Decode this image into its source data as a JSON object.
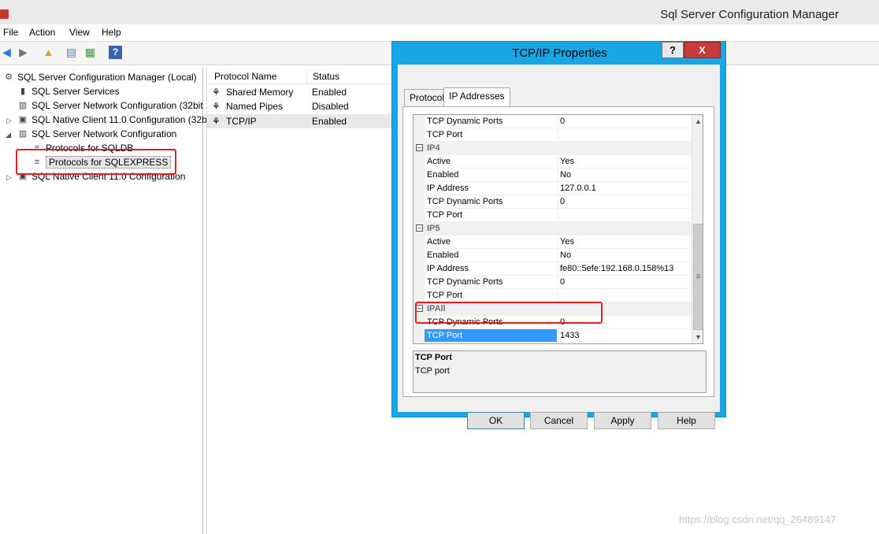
{
  "window": {
    "title": "Sql Server Configuration Manager"
  },
  "menu": [
    "File",
    "Action",
    "View",
    "Help"
  ],
  "tree": {
    "root": "SQL Server Configuration Manager (Local)",
    "items": [
      "SQL Server Services",
      "SQL Server Network Configuration (32bit",
      "SQL Native Client 11.0 Configuration (32b",
      "SQL Server Network Configuration",
      "Protocols for SQLDB",
      "Protocols for SQLEXPRESS",
      "SQL Native Client 11.0 Configuration"
    ]
  },
  "list": {
    "columns": [
      "Protocol Name",
      "Status"
    ],
    "rows": [
      {
        "name": "Shared Memory",
        "status": "Enabled"
      },
      {
        "name": "Named Pipes",
        "status": "Disabled"
      },
      {
        "name": "TCP/IP",
        "status": "Enabled"
      }
    ]
  },
  "dialog": {
    "title": "TCP/IP Properties",
    "help_glyph": "?",
    "close_glyph": "X",
    "tabs": [
      "Protocol",
      "IP Addresses"
    ],
    "grid": {
      "top": [
        {
          "name": "TCP Dynamic Ports",
          "value": "0"
        },
        {
          "name": "TCP Port",
          "value": ""
        }
      ],
      "ip4": {
        "label": "IP4",
        "rows": [
          {
            "name": "Active",
            "value": "Yes"
          },
          {
            "name": "Enabled",
            "value": "No"
          },
          {
            "name": "IP Address",
            "value": "127.0.0.1"
          },
          {
            "name": "TCP Dynamic Ports",
            "value": "0"
          },
          {
            "name": "TCP Port",
            "value": ""
          }
        ]
      },
      "ip5": {
        "label": "IP5",
        "rows": [
          {
            "name": "Active",
            "value": "Yes"
          },
          {
            "name": "Enabled",
            "value": "No"
          },
          {
            "name": "IP Address",
            "value": "fe80::5efe:192.168.0.158%13"
          },
          {
            "name": "TCP Dynamic Ports",
            "value": "0"
          },
          {
            "name": "TCP Port",
            "value": ""
          }
        ]
      },
      "ipall": {
        "label": "IPAll",
        "rows": [
          {
            "name": "TCP Dynamic Ports",
            "value": "0"
          },
          {
            "name": "TCP Port",
            "value": "1433"
          }
        ]
      }
    },
    "description": {
      "title": "TCP Port",
      "text": "TCP port"
    },
    "buttons": [
      "OK",
      "Cancel",
      "Apply",
      "Help"
    ]
  },
  "watermark": "https://blog.csdn.net/qq_26489147",
  "colors": {
    "accent": "#18a7e4",
    "selection": "#3399ff",
    "highlight": "#e02020",
    "close": "#c93b3b"
  }
}
